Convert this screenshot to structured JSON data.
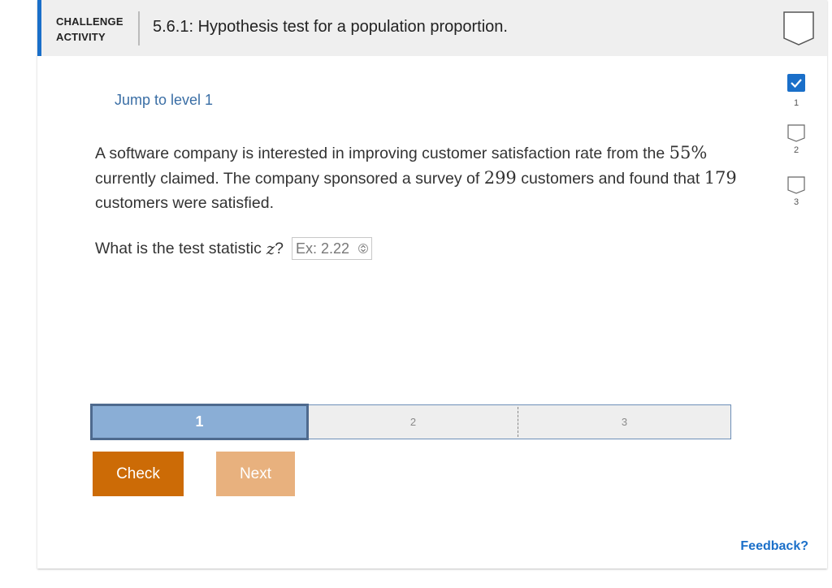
{
  "header": {
    "activity_label_line1": "CHALLENGE",
    "activity_label_line2": "ACTIVITY",
    "title": "5.6.1: Hypothesis test for a population proportion."
  },
  "jump_link": "Jump to level 1",
  "problem": {
    "part1": "A software company is interested in improving customer satisfaction rate from the ",
    "rate": "55%",
    "part2": " currently claimed. The company sponsored a survey of ",
    "survey_n": "299",
    "part3": " customers and found that ",
    "satisfied": "179",
    "part4": " customers were satisfied."
  },
  "question": {
    "prefix": "What is the test statistic",
    "variable": "z",
    "suffix": "?",
    "input_placeholder": "Ex: 2.22",
    "input_value": ""
  },
  "levels": [
    {
      "number": "1",
      "state": "completed"
    },
    {
      "number": "2",
      "state": "empty"
    },
    {
      "number": "3",
      "state": "empty"
    }
  ],
  "progress": {
    "segments": [
      "1",
      "2",
      "3"
    ],
    "active": "1"
  },
  "buttons": {
    "check": "Check",
    "next": "Next"
  },
  "feedback_link": "Feedback?",
  "colors": {
    "accent": "#1a6fc9",
    "check_button": "#cc6b06",
    "next_button": "#e8b17e",
    "active_segment": "#8aaed6"
  }
}
